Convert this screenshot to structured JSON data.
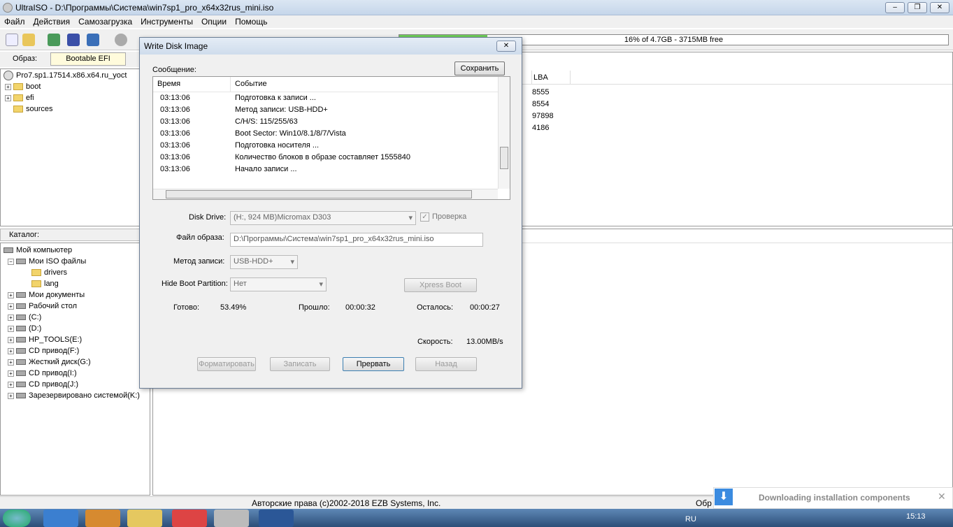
{
  "window": {
    "title": "UltraISO - D:\\Программы\\Система\\win7sp1_pro_x64x32rus_mini.iso",
    "min": "–",
    "max": "❐",
    "close": "✕"
  },
  "menu": [
    "Файл",
    "Действия",
    "Самозагрузка",
    "Инструменты",
    "Опции",
    "Помощь"
  ],
  "capacity": {
    "text": "16% of 4.7GB - 3715MB free",
    "percent": 16
  },
  "image_label": "Образ:",
  "image_type": "Bootable EFI",
  "iso_tree": {
    "root": "Pro7.sp1.17514.x86.x64.ru_yoct",
    "items": [
      "boot",
      "efi",
      "sources"
    ]
  },
  "file_list": {
    "col_lba": "LBA",
    "lba": [
      "8555",
      "8554",
      "97898",
      "4186"
    ]
  },
  "catalog": {
    "header": "Каталог:",
    "items": [
      "Мой компьютер",
      "Мои ISO файлы",
      "drivers",
      "lang",
      "Мои документы",
      "Рабочий стол",
      "(C:)",
      "(D:)",
      "HP_TOOLS(E:)",
      "CD привод(F:)",
      "Жесткий диск(G:)",
      "CD привод(I:)",
      "CD привод(J:)",
      "Зарезервировано системой(K:)"
    ]
  },
  "status": {
    "copyright": "Авторские права (c)2002-2018 EZB Systems, Inc.",
    "right": "Обр"
  },
  "notification": {
    "text": "Downloading installation components",
    "close": "✕"
  },
  "tray": {
    "lang": "RU",
    "time": "15:13"
  },
  "dialog": {
    "title": "Write Disk Image",
    "close": "✕",
    "message_label": "Сообщение:",
    "save": "Сохранить",
    "log_cols": [
      "Время",
      "Событие"
    ],
    "log": [
      [
        "03:13:06",
        "Подготовка к записи ..."
      ],
      [
        "03:13:06",
        "Метод записи: USB-HDD+"
      ],
      [
        "03:13:06",
        "C/H/S: 115/255/63"
      ],
      [
        "03:13:06",
        "Boot Sector: Win10/8.1/8/7/Vista"
      ],
      [
        "03:13:06",
        "Подготовка носителя ..."
      ],
      [
        "03:13:06",
        "Количество блоков в образе составляет 1555840"
      ],
      [
        "03:13:06",
        "Начало записи ..."
      ]
    ],
    "disk_drive_label": "Disk Drive:",
    "disk_drive": "(H:, 924 MB)Micromax D303",
    "verify": "Проверка",
    "image_file_label": "Файл образа:",
    "image_file": "D:\\Программы\\Система\\win7sp1_pro_x64x32rus_mini.iso",
    "method_label": "Метод записи:",
    "method": "USB-HDD+",
    "hide_label": "Hide Boot Partition:",
    "hide": "Нет",
    "xpress": "Xpress Boot",
    "done_label": "Готово:",
    "done": "53.49%",
    "elapsed_label": "Прошло:",
    "elapsed": "00:00:32",
    "remain_label": "Осталось:",
    "remain": "00:00:27",
    "speed_label": "Скорость:",
    "speed": "13.00MB/s",
    "buttons": {
      "format": "Форматировать",
      "write": "Записать",
      "abort": "Прервать",
      "back": "Назад"
    }
  }
}
